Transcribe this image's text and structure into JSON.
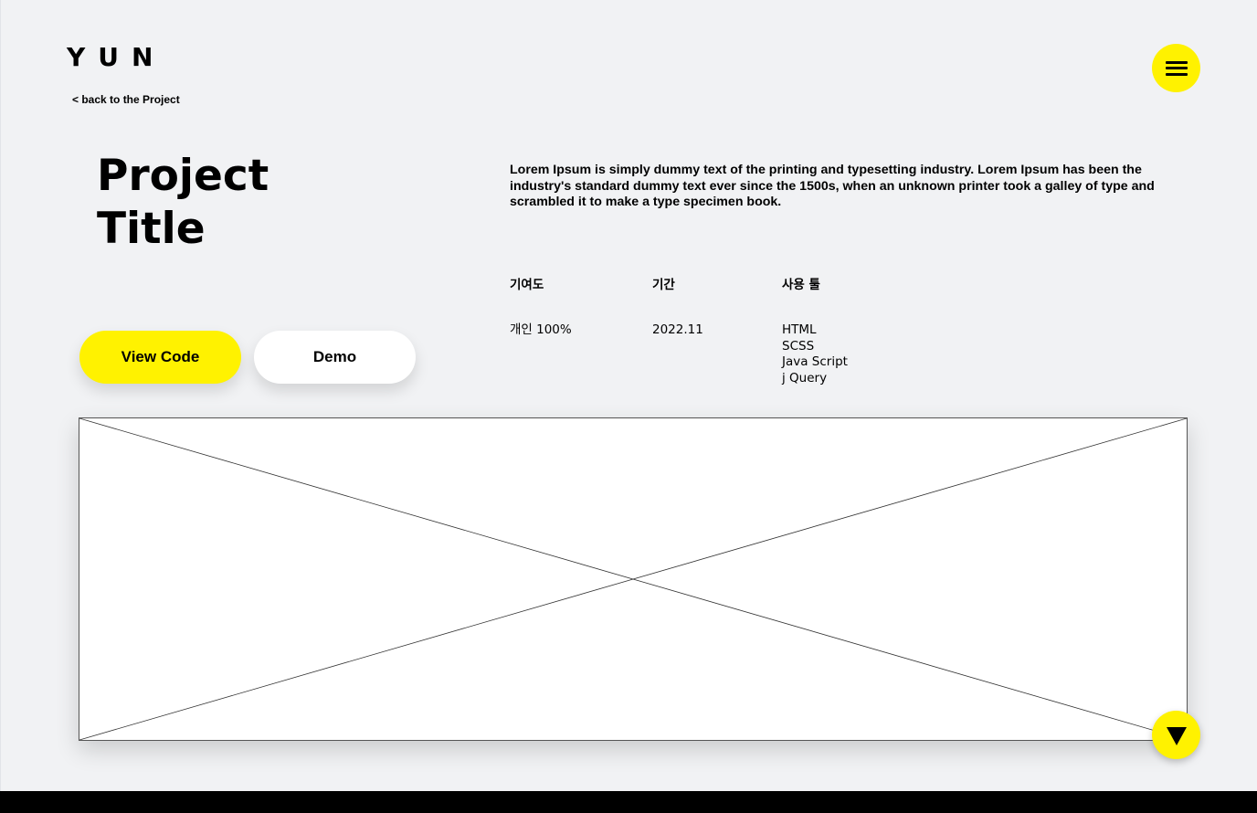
{
  "header": {
    "logo": "YUN",
    "back_link": "< back to the Project",
    "menu_icon": "hamburger-menu-icon"
  },
  "project": {
    "title": "Project Title",
    "description": "Lorem Ipsum is simply dummy text of the printing and typesetting industry. Lorem Ipsum has been the industry's standard dummy text ever since the 1500s, when an unknown printer took a galley of type and scrambled it to make a type specimen book.",
    "buttons": {
      "view_code": "View Code",
      "demo": "Demo"
    },
    "info": {
      "contribution_label": "기여도",
      "contribution_value": "개인 100%",
      "period_label": "기간",
      "period_value": "2022.11",
      "tools_label": "사용 툴",
      "tools": [
        "HTML",
        "SCSS",
        "Java Script",
        "j Query"
      ]
    }
  },
  "scroll_icon": "triangle-down-icon",
  "colors": {
    "accent": "#fff200",
    "background": "#f1f2f4",
    "text": "#000000",
    "footer": "#000000"
  }
}
